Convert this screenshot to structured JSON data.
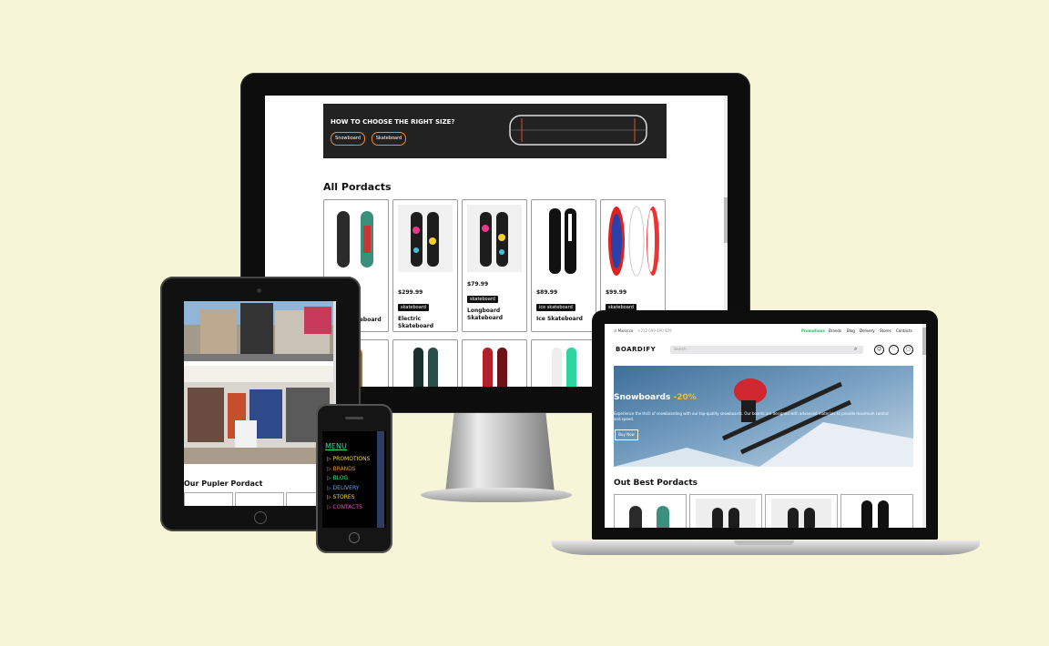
{
  "monitor": {
    "banner": {
      "title": "HOW TO CHOOSE THE RIGHT SIZE?",
      "buttons": [
        "Snowboard",
        "Skateboard"
      ]
    },
    "section_title": "All Pordacts",
    "products": [
      {
        "price": "",
        "tag": "",
        "name": "...eboard"
      },
      {
        "price": "$299.99",
        "tag": "skateboard",
        "name": "Electric Skateboard"
      },
      {
        "price": "$79.99",
        "tag": "skateboard",
        "name": "Longboard Skateboard"
      },
      {
        "price": "$89.99",
        "tag": "ice skateboard",
        "name": "Ice Skateboard"
      },
      {
        "price": "$99.99",
        "tag": "skateboard",
        "name": ""
      }
    ]
  },
  "tablet": {
    "section_title": "Our Pupler Pordact"
  },
  "phone": {
    "menu_title": "MENU",
    "items": [
      {
        "label": "PROMOTIONS",
        "color": "#f7d84b"
      },
      {
        "label": "BRANDS",
        "color": "#f28b2c"
      },
      {
        "label": "BLOG",
        "color": "#3ee07c"
      },
      {
        "label": "DELIVERY",
        "color": "#5aa9ff"
      },
      {
        "label": "STORES",
        "color": "#f7d84b"
      },
      {
        "label": "CONTACTS",
        "color": "#e94fc6"
      }
    ],
    "menu_title_color": "#3ee07c"
  },
  "laptop": {
    "topbar": {
      "location": "Marocco",
      "phone": "+212 699 490 829",
      "nav": [
        "Promotions",
        "Brands",
        "Blog",
        "Delivery",
        "Stores",
        "Contacts"
      ],
      "promo_color": "#19c25c"
    },
    "logo": "BOARDIFY",
    "search": {
      "placeholder": "Search"
    },
    "hero": {
      "title": "Snowboards",
      "discount": "-20%",
      "text": "Experience the thrill of snowboarding with our top-quality snowboards. Our boards are designed with advanced materials to provide maximum control and speed.",
      "button": "Buy Now",
      "accent": "#f5b83b"
    },
    "section_title": "Out Best Pordacts"
  }
}
